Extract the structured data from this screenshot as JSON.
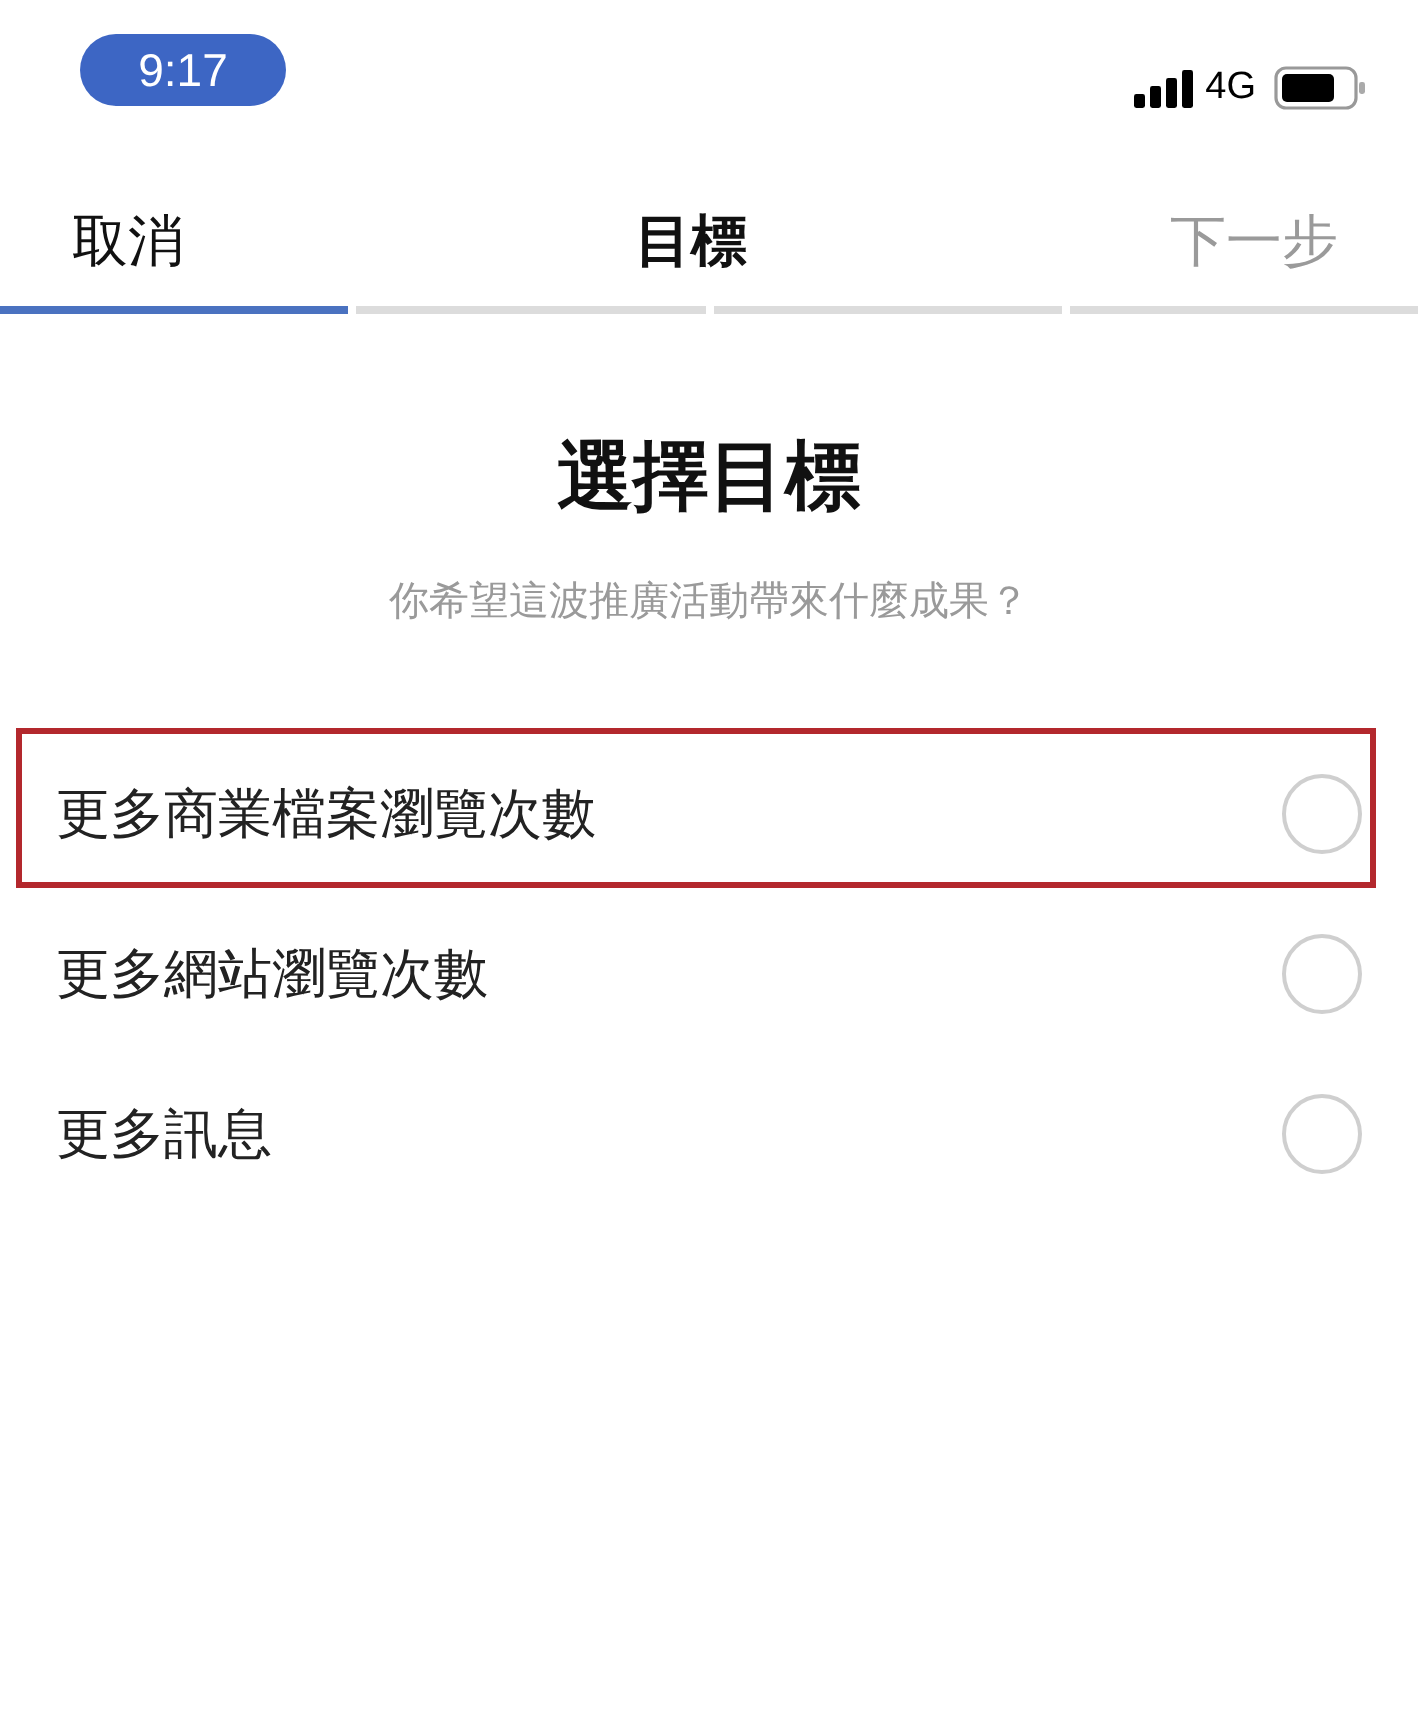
{
  "status_bar": {
    "time": "9:17",
    "network": "4G"
  },
  "nav": {
    "cancel": {
      "label": "取消"
    },
    "title": "目標",
    "next": {
      "label": "下一步",
      "disabled": true
    }
  },
  "progress": {
    "segments": [
      {
        "filled": true
      },
      {
        "filled": false
      },
      {
        "filled": false
      },
      {
        "filled": false
      }
    ]
  },
  "heading": "選擇目標",
  "subheading": "你希望這波推廣活動帶來什麼成果？",
  "options": [
    {
      "label": "更多商業檔案瀏覽次數",
      "selected": false,
      "highlighted": true
    },
    {
      "label": "更多網站瀏覽次數",
      "selected": false,
      "highlighted": false
    },
    {
      "label": "更多訊息",
      "selected": false,
      "highlighted": false
    }
  ]
}
